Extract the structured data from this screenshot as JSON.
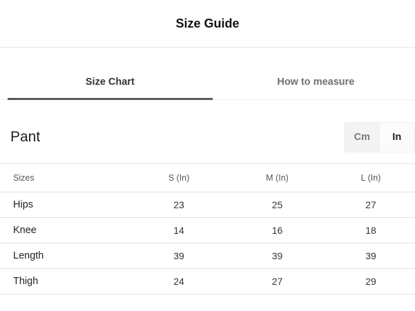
{
  "header": {
    "title": "Size Guide"
  },
  "tabs": [
    {
      "label": "Size Chart",
      "active": true
    },
    {
      "label": "How to measure",
      "active": false
    }
  ],
  "section": {
    "title": "Pant"
  },
  "units": {
    "options": [
      "Cm",
      "In"
    ],
    "selected": "In"
  },
  "table": {
    "headers": [
      "Sizes",
      "S (In)",
      "M (In)",
      "L (In)"
    ],
    "rows": [
      {
        "label": "Hips",
        "values": [
          "23",
          "25",
          "27"
        ]
      },
      {
        "label": "Knee",
        "values": [
          "14",
          "16",
          "18"
        ]
      },
      {
        "label": "Length",
        "values": [
          "39",
          "39",
          "39"
        ]
      },
      {
        "label": "Thigh",
        "values": [
          "24",
          "27",
          "29"
        ]
      }
    ]
  },
  "colors": {
    "active_tab_underline": "#595959",
    "divider": "#e6e6e6",
    "toggle_off_bg": "#f3f3f3"
  }
}
